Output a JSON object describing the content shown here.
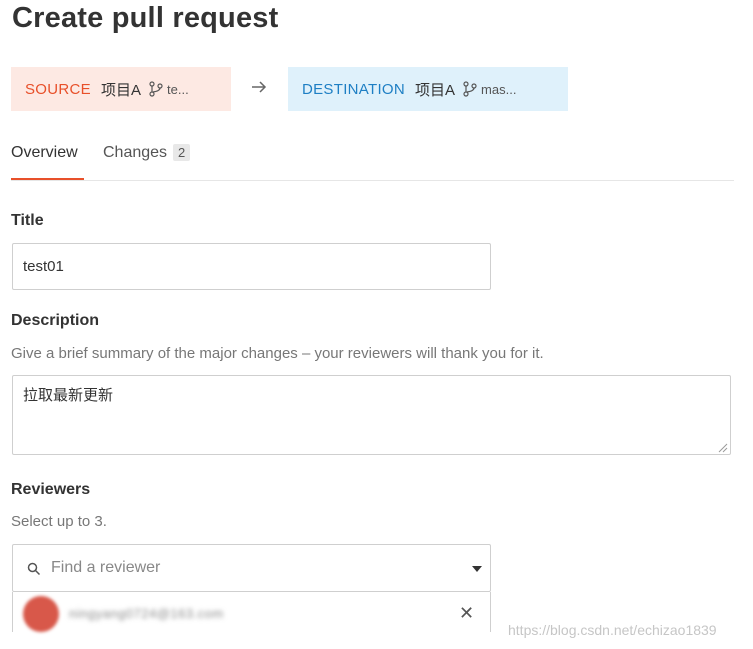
{
  "page": {
    "title": "Create pull request"
  },
  "source": {
    "label": "SOURCE",
    "repo": "项目A",
    "branch": "te..."
  },
  "destination": {
    "label": "DESTINATION",
    "repo": "项目A",
    "branch": "mas..."
  },
  "tabs": [
    {
      "label": "Overview",
      "active": true
    },
    {
      "label": "Changes",
      "count": "2",
      "active": false
    }
  ],
  "form": {
    "title_label": "Title",
    "title_value": "test01",
    "description_label": "Description",
    "description_hint": "Give a brief summary of the major changes – your reviewers will thank you for it.",
    "description_value": "拉取最新更新",
    "reviewers_label": "Reviewers",
    "reviewers_hint": "Select up to 3.",
    "reviewer_placeholder": "Find a reviewer",
    "selected_reviewer": "ningyang0724@163.com"
  },
  "watermark": "https://blog.csdn.net/echizao1839",
  "colors": {
    "source_accent": "#e8502a",
    "destination_accent": "#1e7fc4",
    "source_bg": "#fde9e3",
    "destination_bg": "#dff1fb"
  },
  "icons": [
    "branch-icon",
    "arrow-right-icon",
    "search-icon",
    "caret-down-icon",
    "close-icon",
    "avatar"
  ]
}
